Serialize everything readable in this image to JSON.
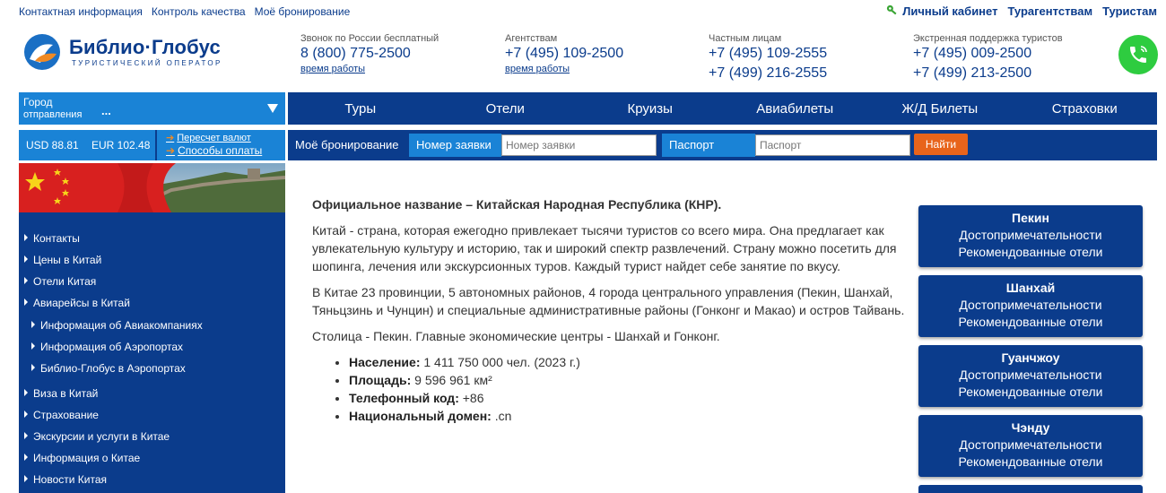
{
  "topbar": {
    "links": [
      "Контактная информация",
      "Контроль качества",
      "Моё бронирование"
    ],
    "right": [
      "Личный кабинет",
      "Турагентствам",
      "Туристам"
    ]
  },
  "logo": {
    "name": "Библио·Глобус",
    "tagline": "ТУРИСТИЧЕСКИЙ ОПЕРАТОР"
  },
  "contacts": [
    {
      "label": "Звонок по России бесплатный",
      "phones": [
        "8 (800) 775-2500"
      ],
      "work_hours": "время работы"
    },
    {
      "label": "Агентствам",
      "phones": [
        "+7 (495) 109-2500"
      ],
      "work_hours": "время работы"
    },
    {
      "label": "Частным лицам",
      "phones": [
        "+7 (495) 109-2555",
        "+7 (499) 216-2555"
      ]
    },
    {
      "label": "Экстренная поддержка туристов",
      "phones": [
        "+7 (495) 009-2500",
        "+7 (499) 213-2500"
      ]
    }
  ],
  "city_select": {
    "line1": "Город",
    "line2": "отправления",
    "value": "..."
  },
  "nav": [
    "Туры",
    "Отели",
    "Круизы",
    "Авиабилеты",
    "Ж/Д Билеты",
    "Страховки"
  ],
  "currency": {
    "usd": "USD 88.81",
    "eur": "EUR 102.48",
    "recalc": "Пересчет валют",
    "payment": "Способы оплаты"
  },
  "booking": {
    "title": "Моё бронирование",
    "order_label": "Номер заявки",
    "order_placeholder": "Номер заявки",
    "passport_label": "Паспорт",
    "passport_placeholder": "Паспорт",
    "submit": "Найти"
  },
  "sidebar": {
    "items": [
      {
        "label": "Контакты",
        "sub": false
      },
      {
        "label": "Цены в Китай",
        "sub": false
      },
      {
        "label": "Отели Китая",
        "sub": false
      },
      {
        "label": "Авиарейсы в Китай",
        "sub": false
      },
      {
        "label": "Информация об Авиакомпаниях",
        "sub": true
      },
      {
        "label": "Информация об Аэропортах",
        "sub": true
      },
      {
        "label": "Библио-Глобус в Аэропортах",
        "sub": true
      },
      {
        "label": "Виза в Китай",
        "sub": false
      },
      {
        "label": "Страхование",
        "sub": false
      },
      {
        "label": "Экскурсии и услуги в Китае",
        "sub": false
      },
      {
        "label": "Информация о Китае",
        "sub": false
      },
      {
        "label": "Новости Китая",
        "sub": false
      }
    ]
  },
  "content": {
    "title": "Официальное название – Китайская Народная Республика (КНР).",
    "p1": "Китай - страна, которая ежегодно привлекает тысячи туристов со всего мира. Она предлагает как увлекательную культуру и историю, так и широкий спектр развлечений. Страну можно посетить для шопинга, лечения или экскурсионных туров. Каждый турист найдет себе занятие по вкусу.",
    "p2": "В Китае 23 провинции, 5 автономных районов, 4 города центрального управления (Пекин, Шанхай, Тяньцзинь и Чунцин) и специальные административные районы (Гонконг и Макао) и остров Тайвань.",
    "p3": "Столица - Пекин. Главные экономические центры - Шанхай и Гонконг.",
    "facts": [
      {
        "k": "Население:",
        "v": "1 411 750 000 чел. (2023 г.)"
      },
      {
        "k": "Площадь:",
        "v": "9 596 961 км²"
      },
      {
        "k": "Телефонный код:",
        "v": "+86"
      },
      {
        "k": "Национальный домен:",
        "v": ".cn"
      }
    ]
  },
  "cities": [
    {
      "name": "Пекин",
      "l1": "Достопримечательности",
      "l2": "Рекомендованные отели"
    },
    {
      "name": "Шанхай",
      "l1": "Достопримечательности",
      "l2": "Рекомендованные отели"
    },
    {
      "name": "Гуанчжоу",
      "l1": "Достопримечательности",
      "l2": "Рекомендованные отели"
    },
    {
      "name": "Чэнду",
      "l1": "Достопримечательности",
      "l2": "Рекомендованные отели"
    }
  ],
  "colors": {
    "brand_dark": "#0b3c8c",
    "brand_light": "#1a83d6",
    "accent": "#e8641b",
    "call": "#2ecc40"
  }
}
